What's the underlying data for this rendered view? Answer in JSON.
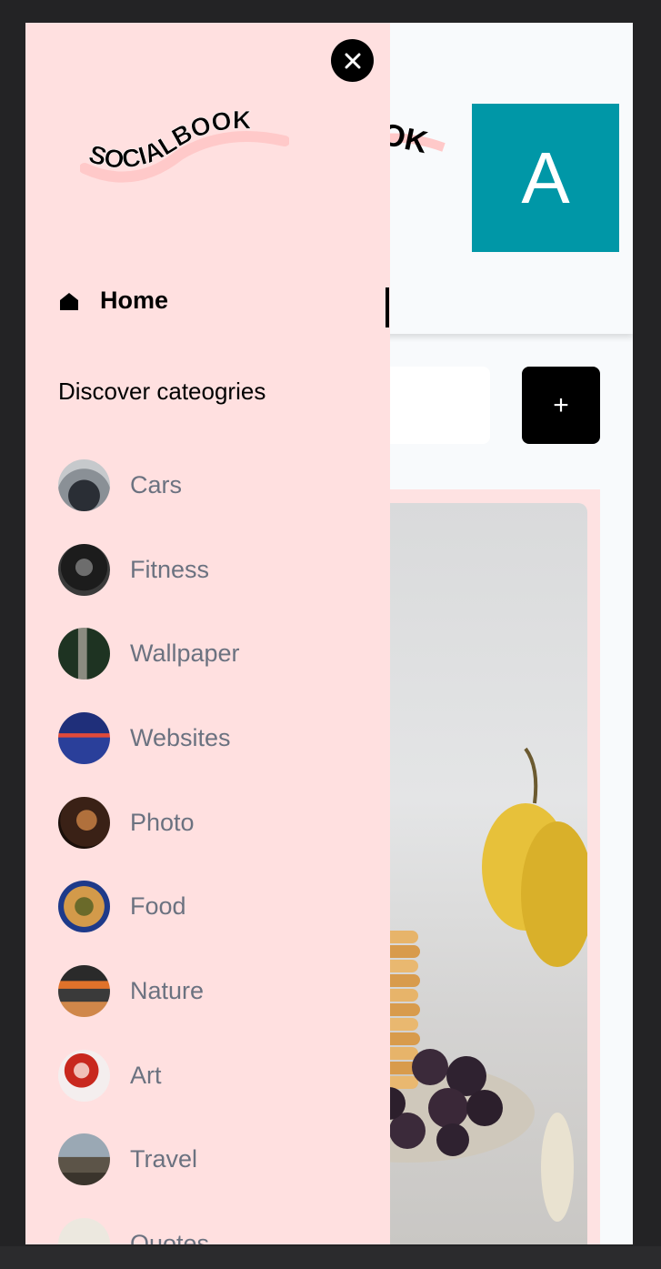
{
  "header": {
    "avatar_initial": "A",
    "add_label": "+"
  },
  "drawer": {
    "logo_text": "SOCIALBOOK",
    "home_label": "Home",
    "section_title": "Discover cateogries",
    "categories": [
      {
        "label": "Cars"
      },
      {
        "label": "Fitness"
      },
      {
        "label": "Wallpaper"
      },
      {
        "label": "Websites"
      },
      {
        "label": "Photo"
      },
      {
        "label": "Food"
      },
      {
        "label": "Nature"
      },
      {
        "label": "Art"
      },
      {
        "label": "Travel"
      },
      {
        "label": "Quotes"
      }
    ]
  },
  "icons": {
    "close": "close-icon",
    "home": "home-icon",
    "add": "plus-icon"
  },
  "colors": {
    "drawer_bg": "#ffe0e0",
    "avatar_bg": "#0097a7",
    "category_text": "#6b7280"
  }
}
